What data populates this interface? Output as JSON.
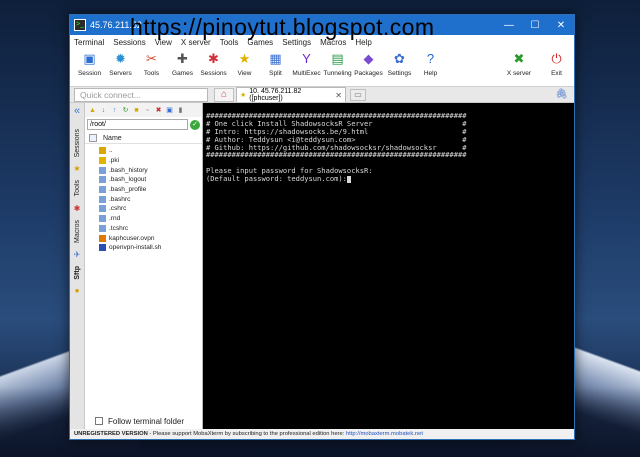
{
  "window": {
    "title": "45.76.211.82",
    "controls": [
      "—",
      "☐",
      "✕"
    ]
  },
  "watermark": "https://pinoytut.blogspot.com",
  "menu": [
    "Terminal",
    "Sessions",
    "View",
    "X server",
    "Tools",
    "Games",
    "Settings",
    "Macros",
    "Help"
  ],
  "toolbar": {
    "items": [
      {
        "label": "Session",
        "icon": "session-icon",
        "glyph": "▣",
        "color": "#2a6fd0"
      },
      {
        "label": "Servers",
        "icon": "servers-icon",
        "glyph": "✹",
        "color": "#2a8fd0"
      },
      {
        "label": "Tools",
        "icon": "tools-icon",
        "glyph": "✂",
        "color": "#d04a2a"
      },
      {
        "label": "Games",
        "icon": "games-icon",
        "glyph": "✚",
        "color": "#555555"
      },
      {
        "label": "Sessions",
        "icon": "sessions-icon",
        "glyph": "✱",
        "color": "#d0303a"
      },
      {
        "label": "View",
        "icon": "view-icon",
        "glyph": "★",
        "color": "#e0b000"
      },
      {
        "label": "Split",
        "icon": "split-icon",
        "glyph": "▦",
        "color": "#3a6fd0"
      },
      {
        "label": "MultiExec",
        "icon": "multiexec-icon",
        "glyph": "Y",
        "color": "#6a2ad0"
      },
      {
        "label": "Tunneling",
        "icon": "tunneling-icon",
        "glyph": "▤",
        "color": "#2a9a4a"
      },
      {
        "label": "Packages",
        "icon": "packages-icon",
        "glyph": "◆",
        "color": "#7a4ad0"
      },
      {
        "label": "Settings",
        "icon": "settings-icon",
        "glyph": "✿",
        "color": "#3a6fd0"
      },
      {
        "label": "Help",
        "icon": "help-icon",
        "glyph": "?",
        "color": "#1f66d0"
      }
    ],
    "right_items": [
      {
        "label": "X server",
        "icon": "x-server-icon",
        "glyph": "✖",
        "color": "#2a9a2a"
      },
      {
        "label": "Exit",
        "icon": "exit-icon",
        "glyph": "⏻",
        "color": "#d02a2a"
      }
    ]
  },
  "quick_connect": {
    "placeholder": "Quick connect..."
  },
  "tabs": {
    "active": "10. 45.76.211.82 ([phcuser])"
  },
  "side_tabs": [
    "Sessions",
    "Tools",
    "Macros",
    "Sftp"
  ],
  "sftp": {
    "path": "/root/",
    "column_name": "Name",
    "files": [
      {
        "name": "..",
        "icon": "folder-up-icon",
        "color": "#d9a800"
      },
      {
        "name": ".pki",
        "icon": "folder-icon",
        "color": "#e0b400"
      },
      {
        "name": ".bash_history",
        "icon": "file-icon",
        "color": "#7aa0d8"
      },
      {
        "name": ".bash_logout",
        "icon": "file-icon",
        "color": "#7aa0d8"
      },
      {
        "name": ".bash_profile",
        "icon": "file-icon",
        "color": "#7aa0d8"
      },
      {
        "name": ".bashrc",
        "icon": "file-icon",
        "color": "#7aa0d8"
      },
      {
        "name": ".cshrc",
        "icon": "file-icon",
        "color": "#7aa0d8"
      },
      {
        "name": ".rnd",
        "icon": "file-icon",
        "color": "#7aa0d8"
      },
      {
        "name": ".tcshrc",
        "icon": "file-icon",
        "color": "#7aa0d8"
      },
      {
        "name": "kaphcuser.ovpn",
        "icon": "ovpn-icon",
        "color": "#e07a00"
      },
      {
        "name": "openvpn-install.sh",
        "icon": "script-icon",
        "color": "#2a4fb0"
      }
    ],
    "follow_label": "Follow terminal folder"
  },
  "terminal": {
    "lines": [
      "#############################################################",
      "# One click Install ShadowsocksR Server                     #",
      "# Intro: https://shadowsocks.be/9.html                      #",
      "# Author: Teddysun <i@teddysun.com>                         #",
      "# Github: https://github.com/shadowsocksr/shadowsocksr      #",
      "#############################################################",
      "",
      "Please input password for ShadowsocksR:",
      "(Default password: teddysun.com):"
    ]
  },
  "status": {
    "bold": "UNREGISTERED VERSION",
    "text": "  -  Please support MobaXterm by subscribing to the professional edition here:  ",
    "link": "http://mobaxterm.mobatek.net"
  }
}
